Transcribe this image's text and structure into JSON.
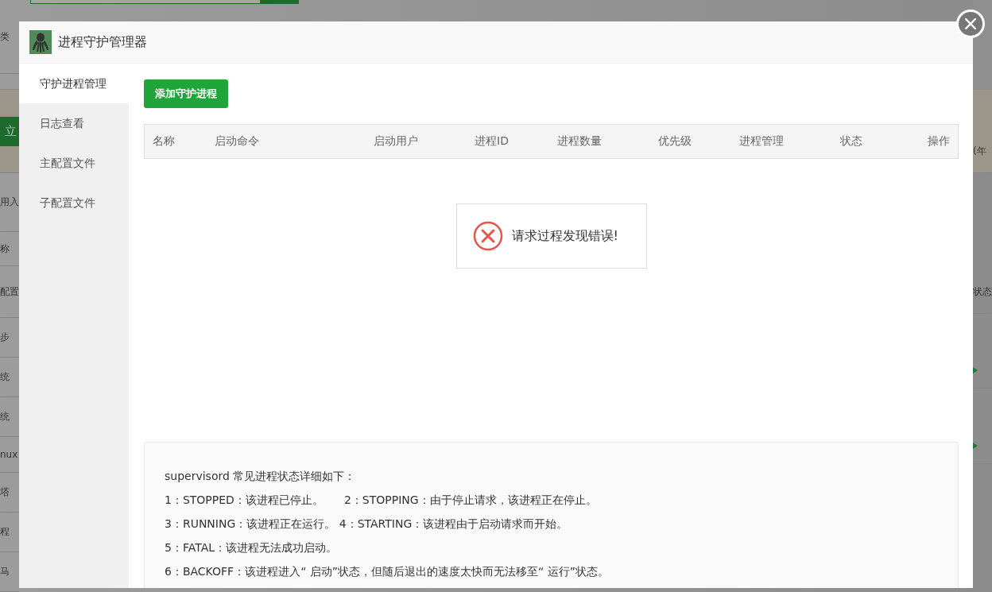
{
  "background": {
    "left_items": [
      {
        "kind": "text",
        "text": "类"
      },
      {
        "kind": "blank"
      },
      {
        "kind": "button",
        "text": "立"
      },
      {
        "kind": "text",
        "text": "用入"
      },
      {
        "kind": "text",
        "text": "称"
      },
      {
        "kind": "text",
        "text": "配置"
      },
      {
        "kind": "text",
        "text": "步"
      },
      {
        "kind": "text",
        "text": "统"
      },
      {
        "kind": "text",
        "text": "统"
      },
      {
        "kind": "text",
        "text": "nux"
      },
      {
        "kind": "text",
        "text": "塔"
      },
      {
        "kind": "text",
        "text": "程"
      },
      {
        "kind": "text",
        "text": "马"
      }
    ],
    "right_items": [
      {
        "kind": "text",
        "text": "(年"
      },
      {
        "kind": "text",
        "text": "状态"
      },
      {
        "kind": "play"
      },
      {
        "kind": "play"
      }
    ]
  },
  "dialog": {
    "title": "进程守护管理器",
    "tabs": [
      {
        "label": "守护进程管理",
        "selected": true
      },
      {
        "label": "日志查看",
        "selected": false
      },
      {
        "label": "主配置文件",
        "selected": false
      },
      {
        "label": "子配置文件",
        "selected": false
      }
    ],
    "add_button": "添加守护进程",
    "table": {
      "columns": [
        "名称",
        "启动命令",
        "启动用户",
        "进程ID",
        "进程数量",
        "优先级",
        "进程管理",
        "状态",
        "操作"
      ]
    },
    "message": "请求过程发现错误!",
    "notes": {
      "heading": "supervisord 常见进程状态详细如下：",
      "lines": [
        [
          "1：STOPPED：该进程已停止。",
          "2：STOPPING：由于停止请求，该进程正在停止。"
        ],
        [
          "3：RUNNING：该进程正在运行。 4：STARTING：该进程由于启动请求而开始。"
        ],
        [
          "5：FATAL：该进程无法成功启动。"
        ],
        [
          "6：BACKOFF：该进程进入“ 启动”状态，但随后退出的速度太快而无法移至“ 运行”状态。"
        ]
      ]
    }
  }
}
